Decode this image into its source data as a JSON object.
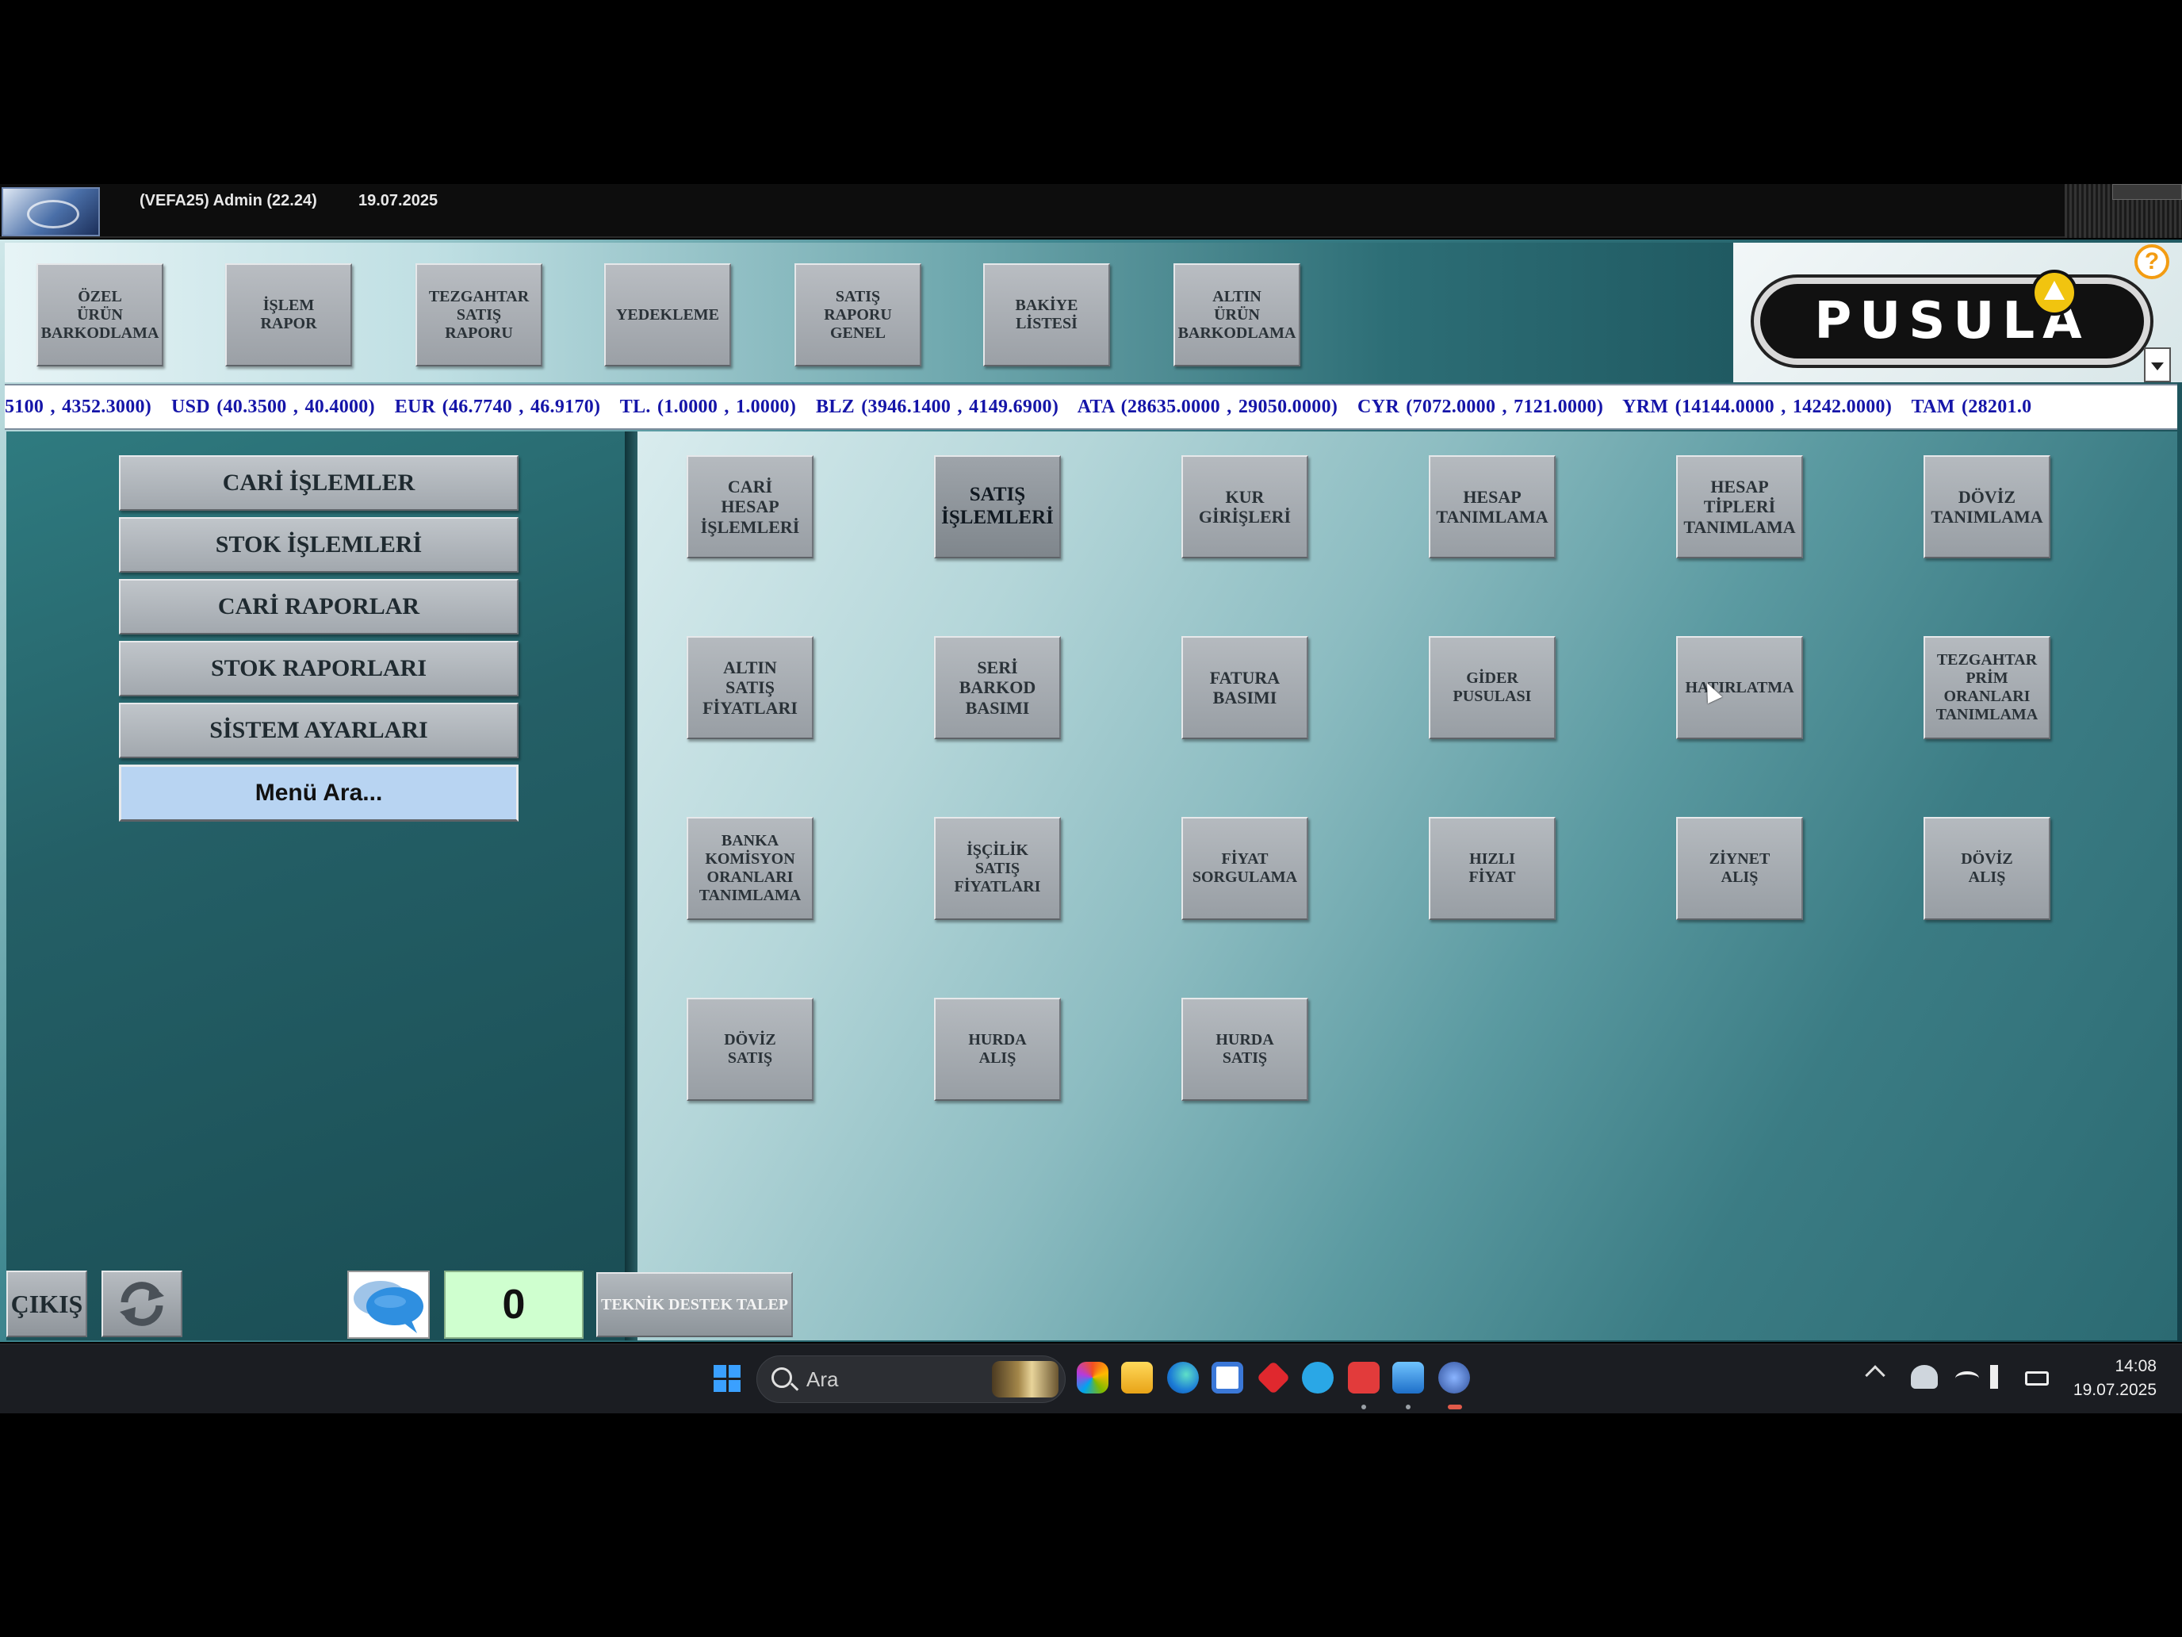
{
  "titlebar": {
    "user": "(VEFA25) Admin (22.24)",
    "date": "19.07.2025"
  },
  "toolbar": {
    "buttons": [
      "ÖZEL\nÜRÜN\nBARKODLAMA",
      "İŞLEM\nRAPOR",
      "TEZGAHTAR\nSATIŞ\nRAPORU",
      "YEDEKLEME",
      "SATIŞ\nRAPORU\nGENEL",
      "BAKİYE\nLİSTESİ",
      "ALTIN\nÜRÜN\nBARKODLAMA"
    ]
  },
  "logo": {
    "text": "PUSULA",
    "help": "?"
  },
  "ticker": {
    "text": "5100 , 4352.3000)   USD (40.3500 , 40.4000)   EUR (46.7740 , 46.9170)   TL. (1.0000 , 1.0000)   BLZ (3946.1400 , 4149.6900)   ATA (28635.0000 , 29050.0000)   CYR (7072.0000 , 7121.0000)   YRM (14144.0000 , 14242.0000)   TAM (28201.0"
  },
  "left_menu": {
    "items": [
      "CARİ İŞLEMLER",
      "STOK İŞLEMLERİ",
      "CARİ RAPORLAR",
      "STOK RAPORLARI",
      "SİSTEM AYARLARI"
    ],
    "search": "Menü Ara..."
  },
  "grid": {
    "row1": [
      "CARİ\nHESAP\nİŞLEMLERİ",
      "SATIŞ\nİŞLEMLERİ",
      "KUR\nGİRİŞLERİ",
      "HESAP\nTANIMLAMA",
      "HESAP\nTİPLERİ\nTANIMLAMA",
      "DÖVİZ\nTANIMLAMA"
    ],
    "row2": [
      "ALTIN\nSATIŞ\nFİYATLARI",
      "SERİ\nBARKOD\nBASIMI",
      "FATURA\nBASIMI",
      "GİDER\nPUSULASI",
      "HATIRLATMA",
      "TEZGAHTAR\nPRİM\nORANLARI\nTANIMLAMA"
    ],
    "row3": [
      "BANKA\nKOMİSYON\nORANLARI\nTANIMLAMA",
      "İŞÇİLİK\nSATIŞ\nFİYATLARI",
      "FİYAT\nSORGULAMA",
      "HIZLI\nFİYAT",
      "ZİYNET\nALIŞ",
      "DÖVİZ\nALIŞ"
    ],
    "row4": [
      "DÖVİZ\nSATIŞ",
      "HURDA\nALIŞ",
      "HURDA\nSATIŞ"
    ]
  },
  "bottom": {
    "exit": "ÇIKIŞ",
    "counter": "0",
    "support": "TEKNİK DESTEK TALEP"
  },
  "taskbar": {
    "search_label": "Ara",
    "time": "14:08",
    "date": "19.07.2025"
  }
}
